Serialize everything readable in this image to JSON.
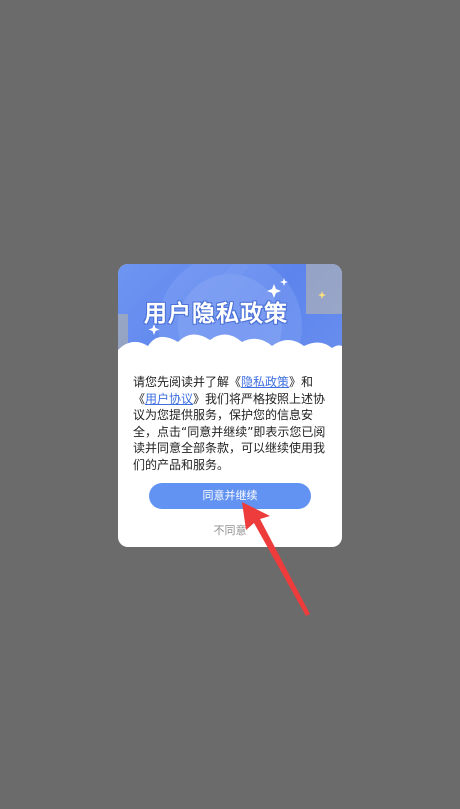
{
  "dialog": {
    "banner_title": "用户隐私政策",
    "text_before_privacy": "请您先阅读并了解《",
    "privacy_link": "隐私政策",
    "text_between": "》和《",
    "agreement_link": "用户协议",
    "text_after": "》我们将严格按照上述协议为您提供服务，保护您的信息安全，点击“同意并继续”即表示您已阅读并同意全部条款，可以继续使用我们的产品和服务。",
    "agree_button": "同意并继续",
    "decline_link": "不同意"
  },
  "colors": {
    "overlay": "#6b6b6b",
    "banner": "#5c84ec",
    "button": "#6393f2",
    "link": "#3d6fe0",
    "arrow": "#ee3b3b"
  }
}
